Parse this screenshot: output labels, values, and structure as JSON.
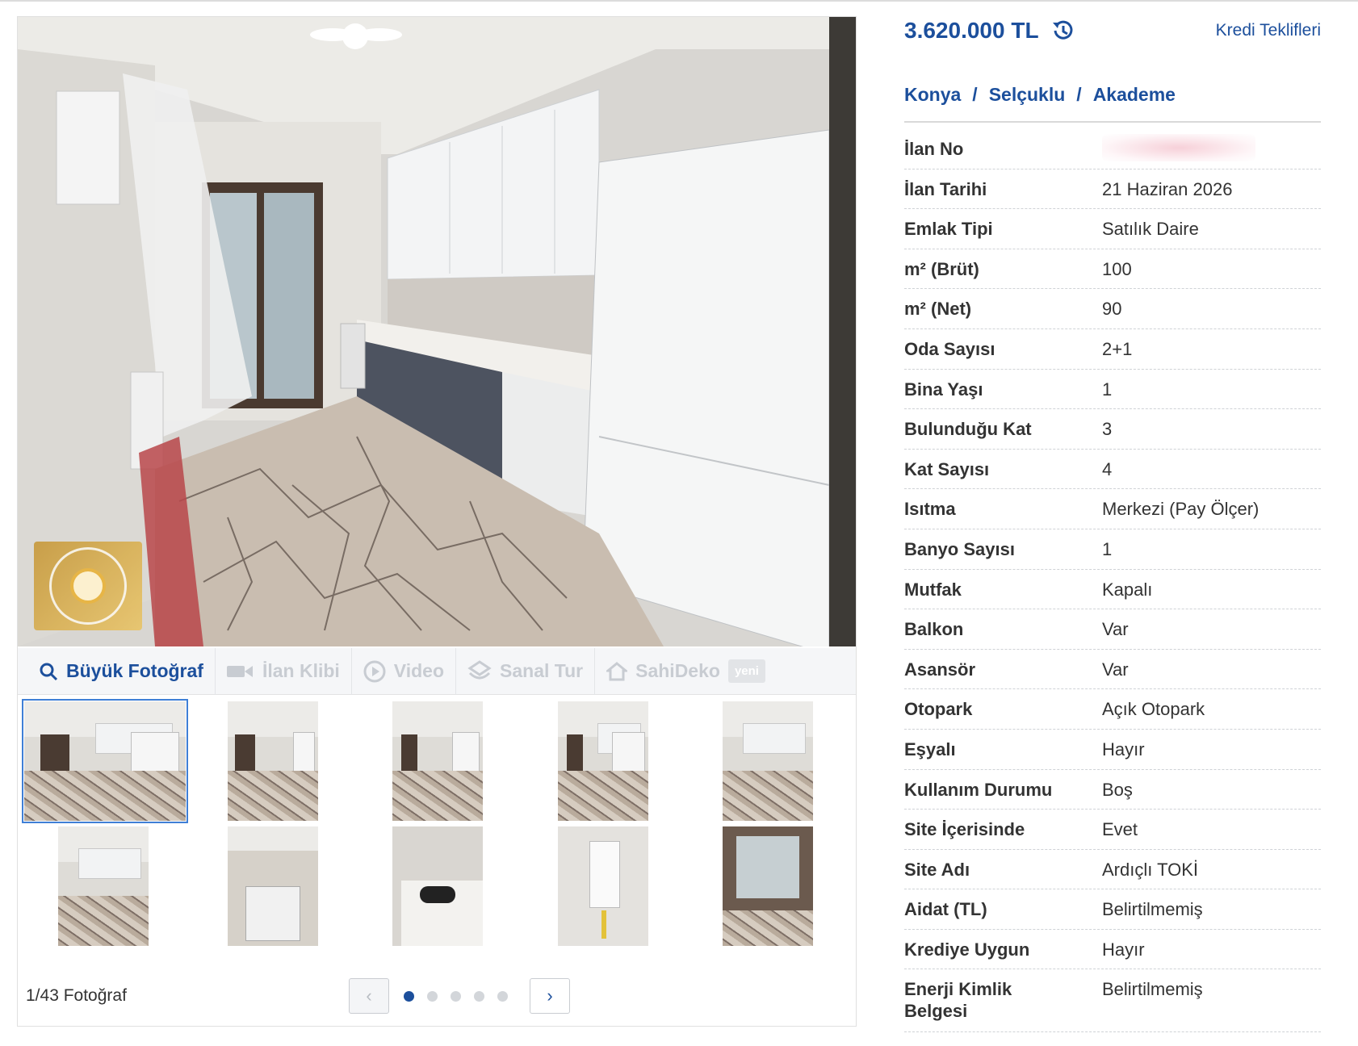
{
  "gallery": {
    "toolbar": {
      "large_photo": "Büyük Fotoğraf",
      "listing_clip": "İlan Klibi",
      "video": "Video",
      "virtual_tour": "Sanal Tur",
      "sahideko": "SahiDeko",
      "new_badge": "yeni"
    },
    "photo_count": "1/43 Fotoğraf",
    "pager": {
      "prev": "‹",
      "next": "›",
      "pages": 5,
      "current_page": 1
    }
  },
  "listing": {
    "price": "3.620.000 TL",
    "loan_offers": "Kredi Teklifleri",
    "location": {
      "city": "Konya",
      "district": "Selçuklu",
      "neighborhood": "Akademe",
      "separator": "/"
    },
    "details": [
      {
        "key": "İlan No",
        "value": ""
      },
      {
        "key": "İlan Tarihi",
        "value": "21 Haziran 2026"
      },
      {
        "key": "Emlak Tipi",
        "value": "Satılık Daire"
      },
      {
        "key": "m² (Brüt)",
        "value": "100"
      },
      {
        "key": "m² (Net)",
        "value": "90"
      },
      {
        "key": "Oda Sayısı",
        "value": "2+1"
      },
      {
        "key": "Bina Yaşı",
        "value": "1"
      },
      {
        "key": "Bulunduğu Kat",
        "value": "3"
      },
      {
        "key": "Kat Sayısı",
        "value": "4"
      },
      {
        "key": "Isıtma",
        "value": "Merkezi (Pay Ölçer)"
      },
      {
        "key": "Banyo Sayısı",
        "value": "1"
      },
      {
        "key": "Mutfak",
        "value": "Kapalı"
      },
      {
        "key": "Balkon",
        "value": "Var"
      },
      {
        "key": "Asansör",
        "value": "Var"
      },
      {
        "key": "Otopark",
        "value": "Açık Otopark"
      },
      {
        "key": "Eşyalı",
        "value": "Hayır"
      },
      {
        "key": "Kullanım Durumu",
        "value": "Boş"
      },
      {
        "key": "Site İçerisinde",
        "value": "Evet"
      },
      {
        "key": "Site Adı",
        "value": "Ardıçlı TOKİ"
      },
      {
        "key": "Aidat (TL)",
        "value": "Belirtilmemiş"
      },
      {
        "key": "Krediye Uygun",
        "value": "Hayır"
      },
      {
        "key": "Enerji Kimlik Belgesi",
        "value": "Belirtilmemiş"
      }
    ]
  },
  "colors": {
    "accent": "#1c4f9c",
    "muted": "#c8ccd2",
    "rule": "#cfd2d6"
  },
  "icons": [
    "search-icon",
    "video-camera-icon",
    "play-circle-icon",
    "virtual-tour-icon",
    "house-icon",
    "history-icon",
    "chevron-left-icon",
    "chevron-right-icon"
  ]
}
